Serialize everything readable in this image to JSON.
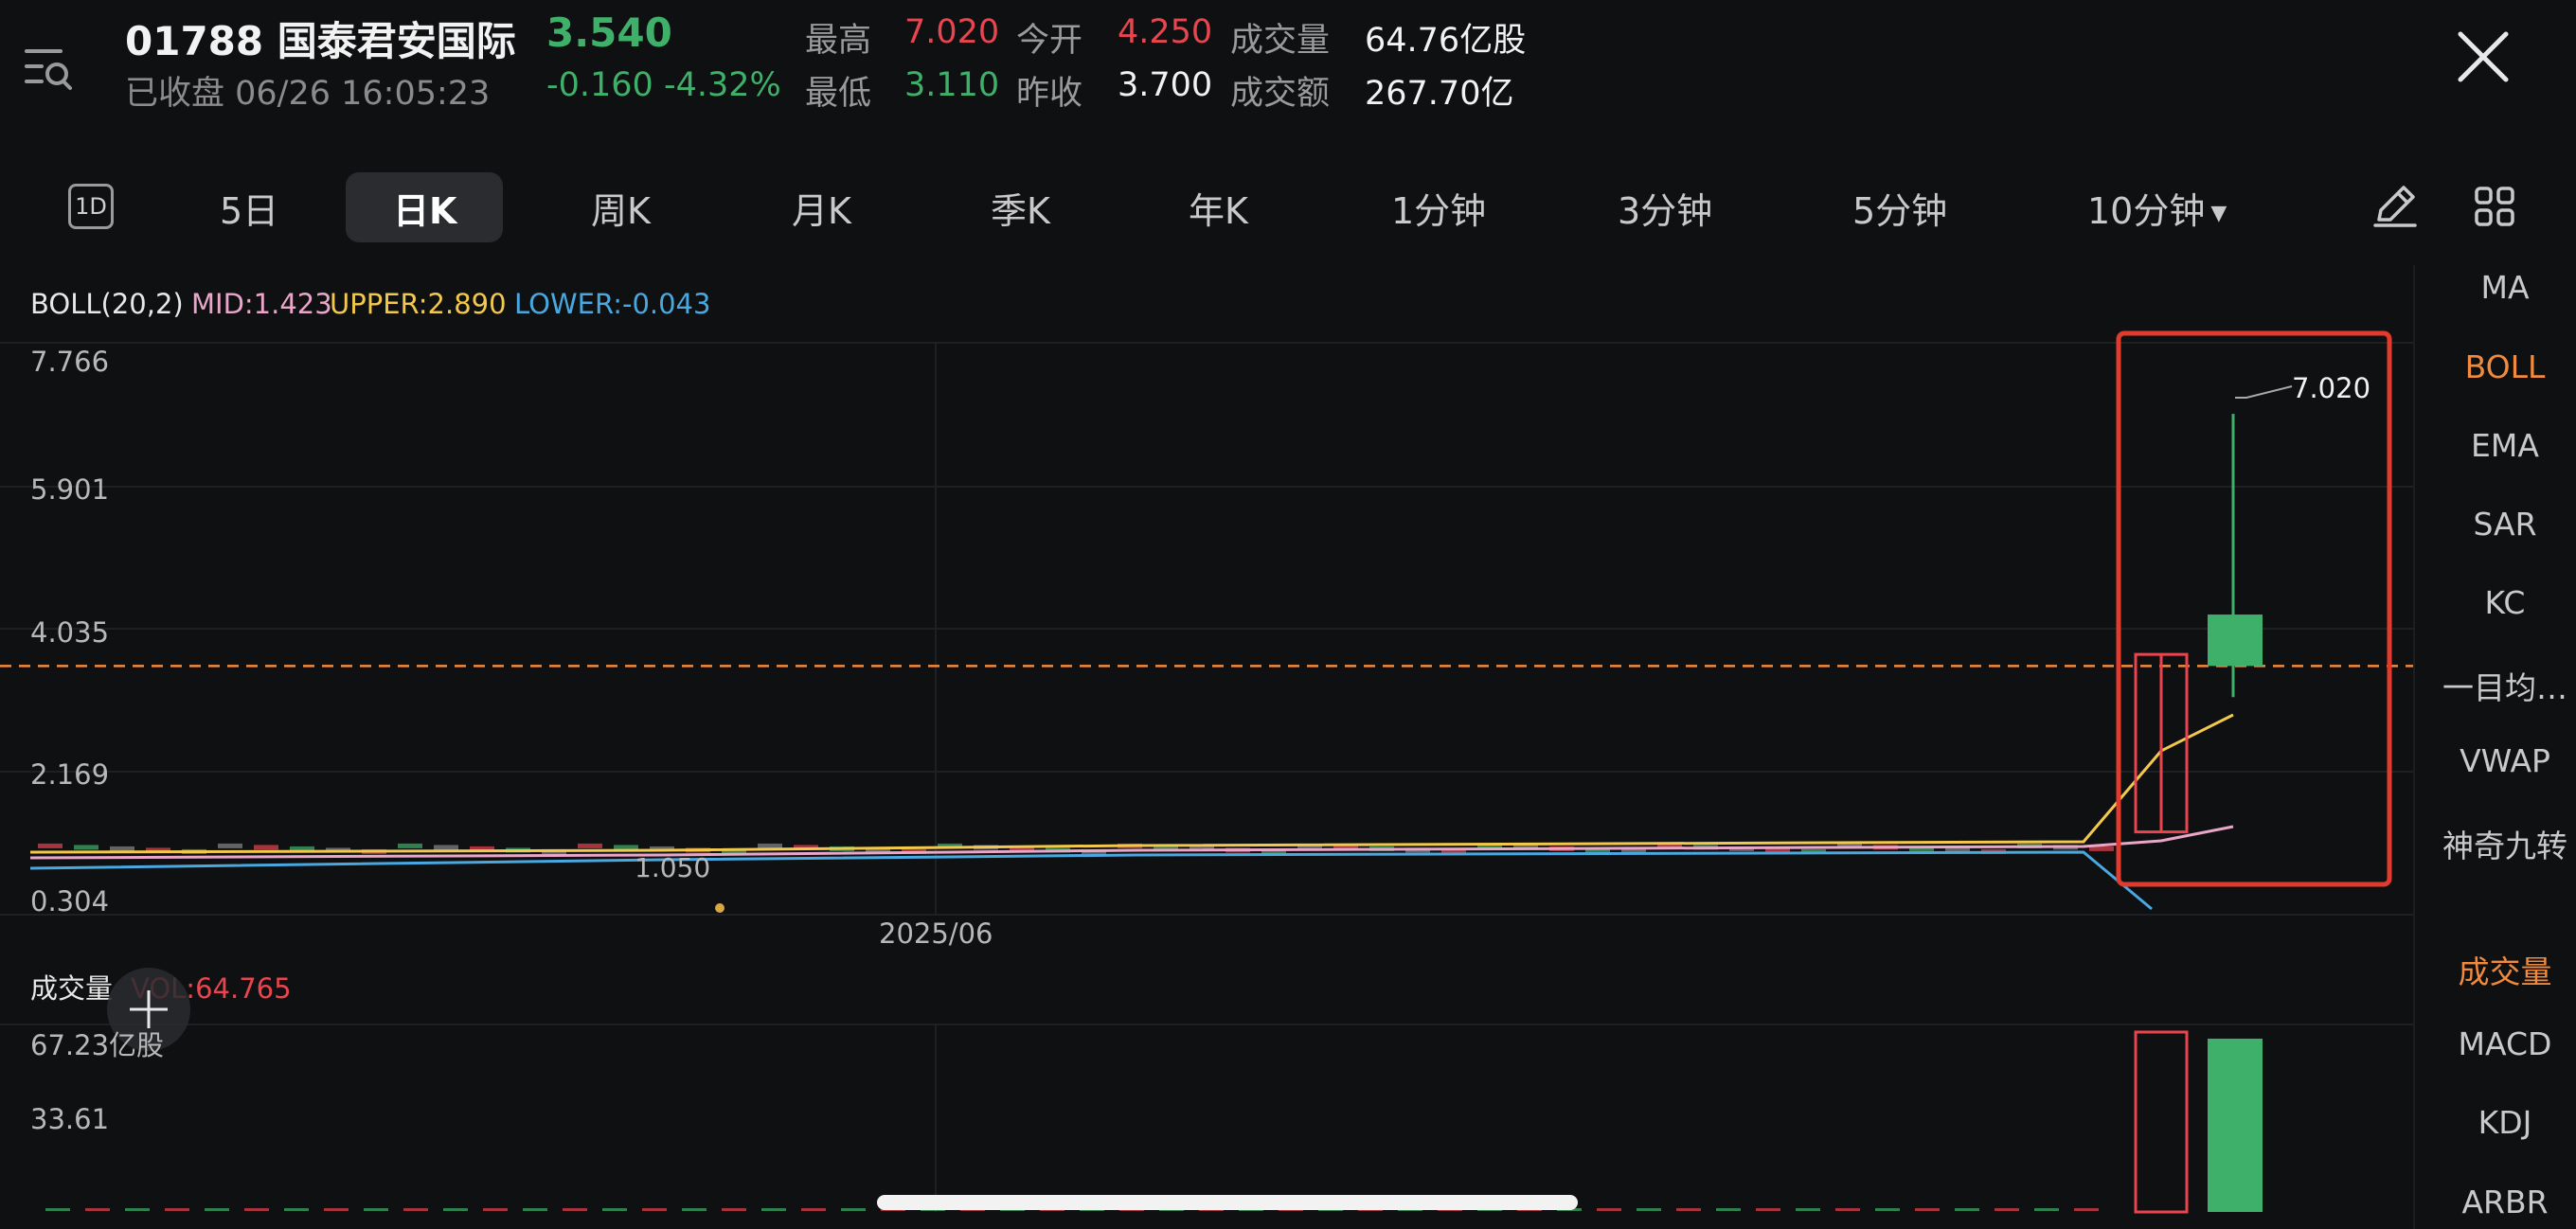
{
  "header": {
    "stock_code_name": "01788 国泰君安国际",
    "last_price": "3.540",
    "status": "已收盘 06/26 16:05:23",
    "change": "-0.160 -4.32%",
    "quotes": [
      {
        "label": "最高",
        "value": "7.020",
        "color": "#e8454f"
      },
      {
        "label": "今开",
        "value": "4.250",
        "color": "#e8454f"
      },
      {
        "label": "成交量",
        "value": "64.76亿股",
        "color": "#f2f2f2"
      },
      {
        "label": "最低",
        "value": "3.110",
        "color": "#3fb06a"
      },
      {
        "label": "昨收",
        "value": "3.700",
        "color": "#f2f2f2"
      },
      {
        "label": "成交额",
        "value": "267.70亿",
        "color": "#f2f2f2"
      }
    ]
  },
  "tabs": {
    "icon_label": "1D",
    "items": [
      "5日",
      "日K",
      "周K",
      "月K",
      "季K",
      "年K",
      "1分钟",
      "3分钟",
      "5分钟",
      "10分钟"
    ],
    "active": "日K"
  },
  "boll": {
    "name": "BOLL(20,2)",
    "mid": "MID:1.423",
    "upper": "UPPER:2.890",
    "lower": "LOWER:-0.043"
  },
  "volume": {
    "label": "成交量",
    "vol": "VOL:64.765"
  },
  "side_indicators": {
    "main": [
      "MA",
      "BOLL",
      "EMA",
      "SAR",
      "KC",
      "一目均…",
      "VWAP",
      "神奇九转"
    ],
    "sub": [
      "成交量",
      "MACD",
      "KDJ",
      "ARBR"
    ],
    "active_main": "BOLL",
    "active_sub": "成交量"
  },
  "colors": {
    "up": "#e8454f",
    "down": "#3fb06a",
    "mid": "#e9a6c8",
    "upper": "#f2c94c",
    "lower": "#4aa8e0",
    "accent": "#f08a3c",
    "highlight_box": "#e23b2e"
  },
  "chart_data": [
    {
      "type": "candlestick",
      "y_ticks": [
        "7.766",
        "5.901",
        "4.035",
        "2.169",
        "0.304"
      ],
      "ylim": [
        0.304,
        7.766
      ],
      "x_tick": "2025/06",
      "current_price_line": 3.54,
      "min_label": "1.050",
      "max_label": "7.020",
      "candles": [
        {
          "label": "prev",
          "open": 1.25,
          "close": 3.7,
          "high": 3.7,
          "low": 1.25,
          "direction": "up"
        },
        {
          "label": "06/26",
          "open": 4.25,
          "close": 3.54,
          "high": 7.02,
          "low": 3.11,
          "direction": "down"
        }
      ],
      "boll": {
        "mid": 1.423,
        "upper": 2.89,
        "lower": -0.043
      }
    },
    {
      "type": "bar",
      "y_ticks": [
        "67.23亿股",
        "33.61"
      ],
      "ylim": [
        0,
        67.23
      ],
      "bars": [
        {
          "label": "prev",
          "value": 67.23,
          "direction": "up"
        },
        {
          "label": "06/26",
          "value": 64.765,
          "direction": "down"
        }
      ]
    }
  ]
}
